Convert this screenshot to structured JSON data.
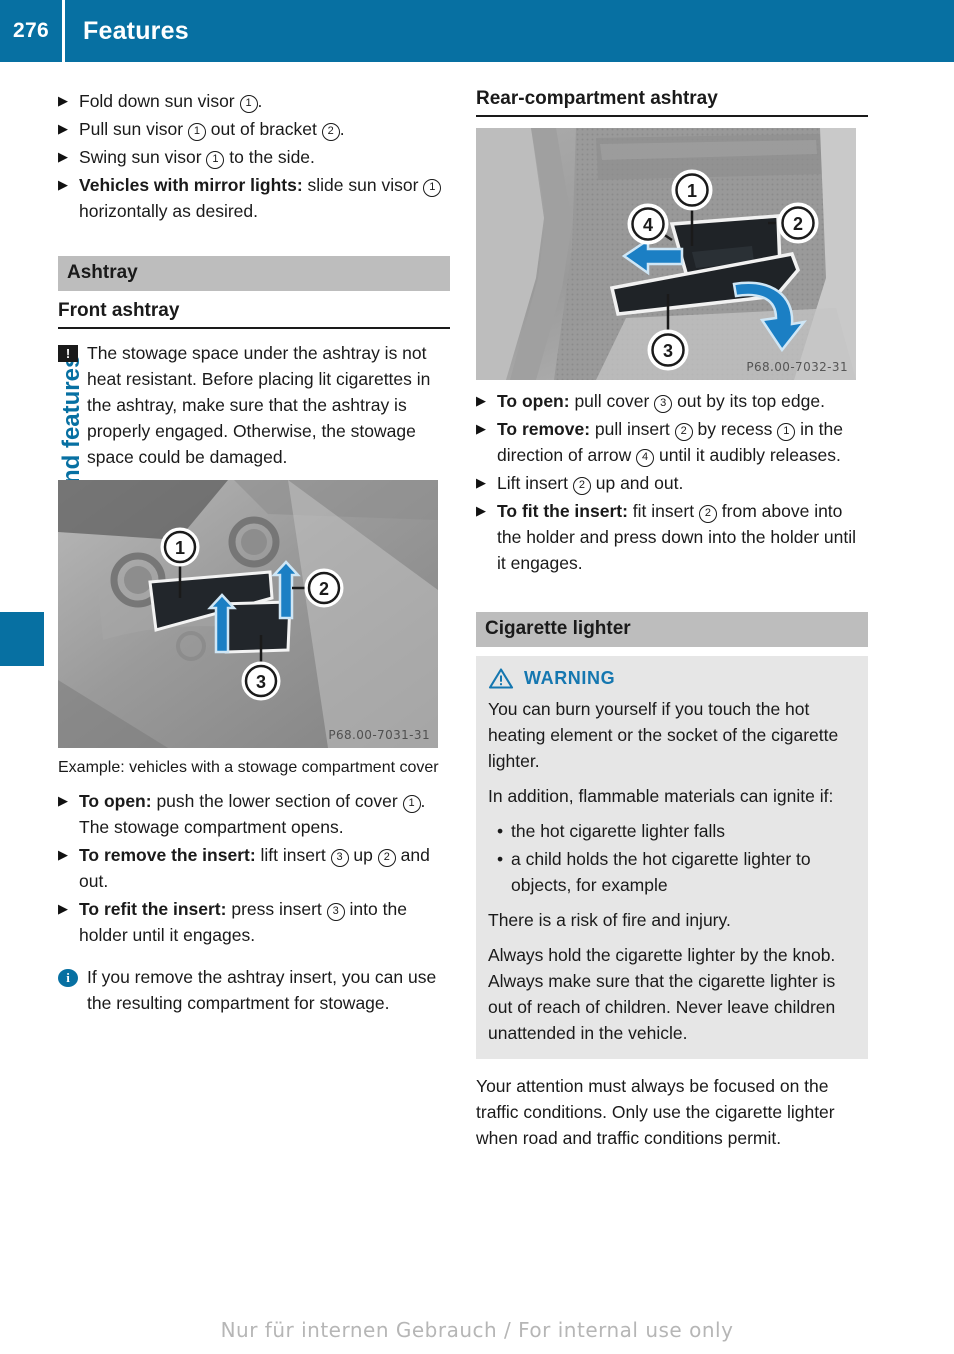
{
  "header": {
    "page_number": "276",
    "title": "Features",
    "bar_color": "#0770A2"
  },
  "chapter_tab": {
    "label": "Stowing and features",
    "color": "#0770A2"
  },
  "left_column": {
    "sun_visor_steps": [
      {
        "bullet": "▶",
        "html": "Fold down sun visor <span class=\"cn\">1</span>."
      },
      {
        "bullet": "▶",
        "html": "Pull sun visor <span class=\"cn\">1</span> out of bracket <span class=\"cn\">2</span>."
      },
      {
        "bullet": "▶",
        "html": "Swing sun visor <span class=\"cn\">1</span> to the side."
      },
      {
        "bullet": "▶",
        "html": "<b>Vehicles with mirror lights:</b> slide sun visor <span class=\"cn\">1</span> horizontally as desired."
      }
    ],
    "section_band": "Ashtray",
    "subhead": "Front ashtray",
    "notice": {
      "icon": "!",
      "text": "The stowage space under the ashtray is not heat resistant. Before placing lit cigarettes in the ashtray, make sure that the ashtray is properly engaged. Otherwise, the stowage space could be damaged."
    },
    "figure": {
      "code": "P68.00-7031-31",
      "callouts": [
        "1",
        "2",
        "3"
      ]
    },
    "caption": "Example: vehicles with a stowage compartment cover",
    "ashtray_steps": [
      {
        "bullet": "▶",
        "html": "<b>To open:</b> push the lower section of cover <span class=\"cn\">1</span>.<br>The stowage compartment opens."
      },
      {
        "bullet": "▶",
        "html": "<b>To remove the insert:</b> lift insert <span class=\"cn\">3</span> up <span class=\"cn\">2</span> and out."
      },
      {
        "bullet": "▶",
        "html": "<b>To refit the insert:</b> press insert <span class=\"cn\">3</span> into the holder until it engages."
      }
    ],
    "info": {
      "icon": "i",
      "text": "If you remove the ashtray insert, you can use the resulting compartment for stowage."
    }
  },
  "right_column": {
    "subhead": "Rear-compartment ashtray",
    "figure": {
      "code": "P68.00-7032-31",
      "callouts": [
        "1",
        "2",
        "3",
        "4"
      ]
    },
    "rear_steps": [
      {
        "bullet": "▶",
        "html": "<b>To open:</b> pull cover <span class=\"cn\">3</span> out by its top edge."
      },
      {
        "bullet": "▶",
        "html": "<b>To remove:</b> pull insert <span class=\"cn\">2</span> by recess <span class=\"cn\">1</span> in the direction of arrow <span class=\"cn\">4</span> until it audibly releases."
      },
      {
        "bullet": "▶",
        "html": "Lift insert <span class=\"cn\">2</span> up and out."
      },
      {
        "bullet": "▶",
        "html": "<b>To fit the insert:</b> fit insert <span class=\"cn\">2</span> from above into the holder and press down into the holder until it engages."
      }
    ],
    "section_band": "Cigarette lighter",
    "warning": {
      "title": "WARNING",
      "title_color": "#1577B0",
      "paragraphs": [
        "You can burn yourself if you touch the hot heating element or the socket of the cigarette lighter.",
        "In addition, flammable materials can ignite if:"
      ],
      "bullets": [
        "the hot cigarette lighter falls",
        "a child holds the hot cigarette lighter to objects, for example"
      ],
      "paragraphs_after": [
        "There is a risk of fire and injury.",
        "Always hold the cigarette lighter by the knob. Always make sure that the cigarette lighter is out of reach of children. Never leave children unattended in the vehicle."
      ]
    },
    "closing_paragraph": "Your attention must always be focused on the traffic conditions. Only use the cigarette lighter when road and traffic conditions permit."
  },
  "footer": {
    "watermark": "Nur für internen Gebrauch / For internal use only"
  }
}
